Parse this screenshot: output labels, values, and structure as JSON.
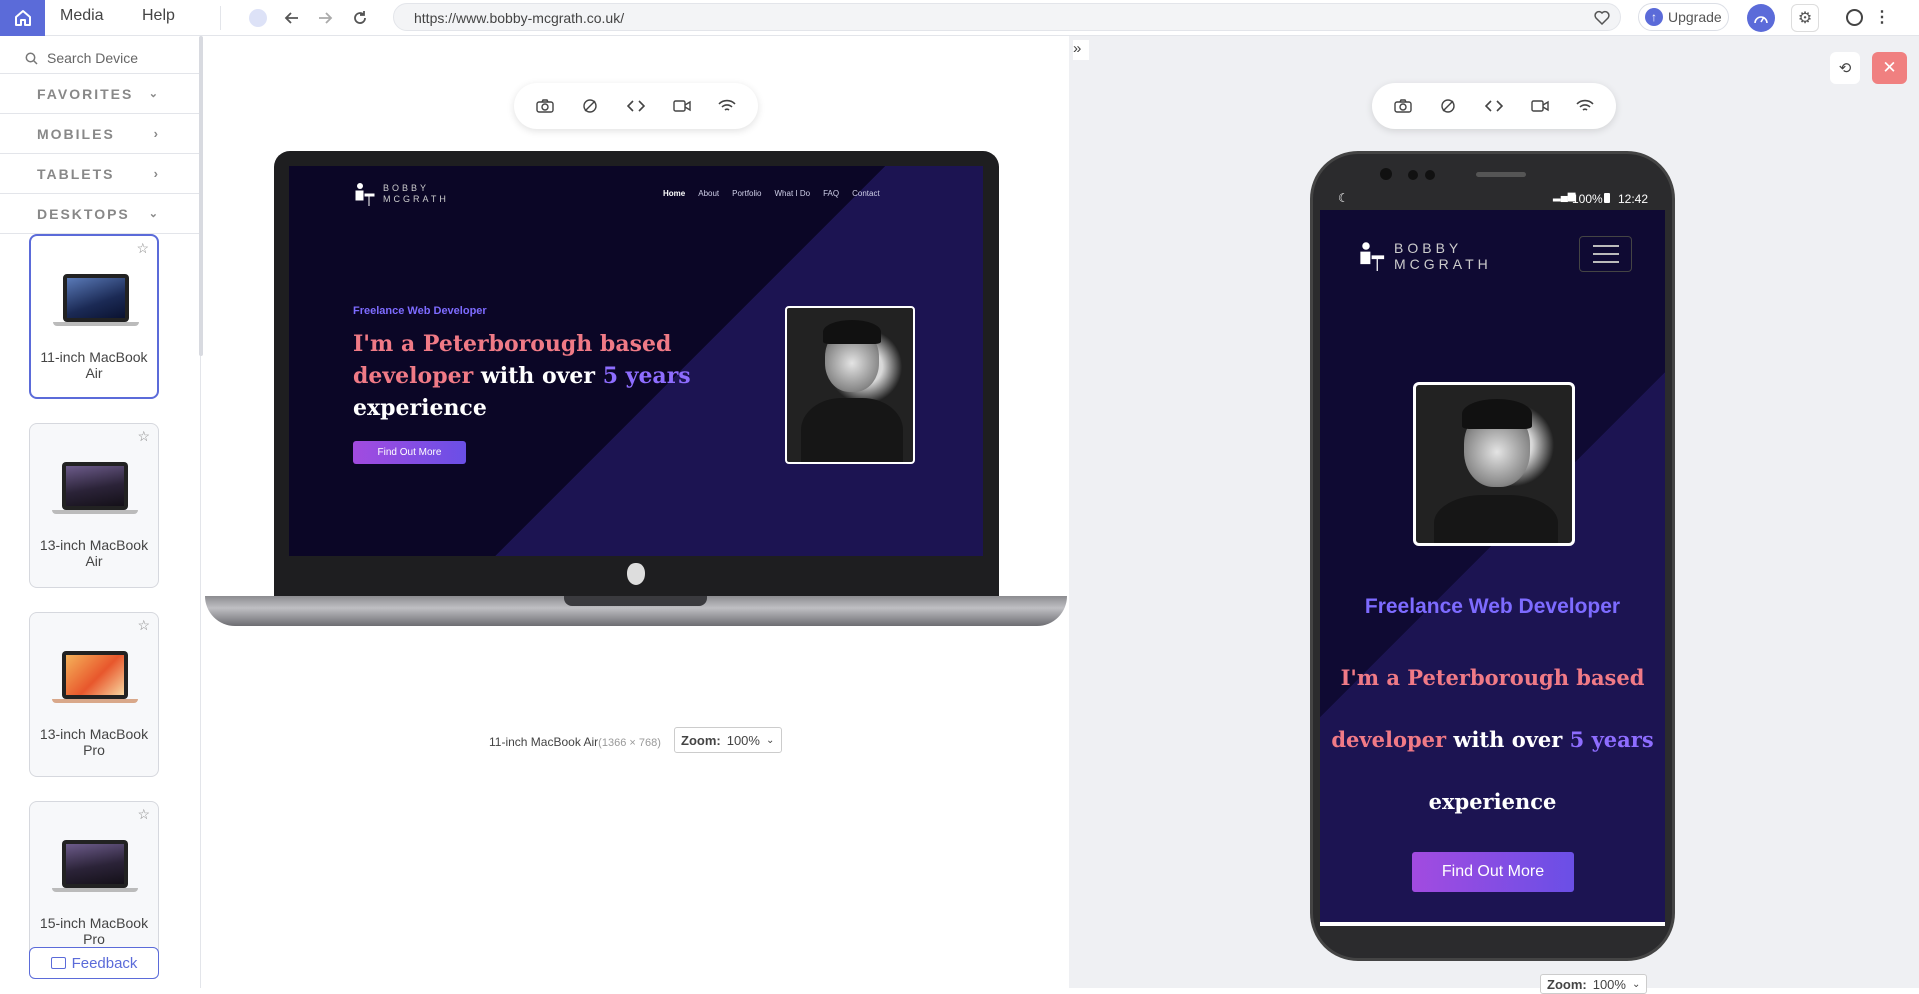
{
  "menu": {
    "media": "Media",
    "help": "Help"
  },
  "browser": {
    "url": "https://www.bobby-mcgrath.co.uk/",
    "upgrade": "Upgrade"
  },
  "sidebar": {
    "search_placeholder": "Search Device",
    "categories": [
      "FAVORITES",
      "MOBILES",
      "TABLETS",
      "DESKTOPS"
    ],
    "devices": [
      {
        "name": "11-inch MacBook Air"
      },
      {
        "name": "13-inch MacBook Air"
      },
      {
        "name": "13-inch MacBook Pro"
      },
      {
        "name": "15-inch MacBook Pro"
      }
    ],
    "feedback": "Feedback"
  },
  "site": {
    "logo_line1": "BOBBY",
    "logo_line2": "MCGRATH",
    "nav": [
      "Home",
      "About",
      "Portfolio",
      "What I Do",
      "FAQ",
      "Contact"
    ],
    "eyebrow": "Freelance Web Developer",
    "headline_1": "I'm a Peterborough based",
    "headline_2a": "developer",
    "headline_2b": "with over",
    "headline_2c": "5 years",
    "headline_3": "experience",
    "cta": "Find Out More"
  },
  "laptop_footer": {
    "device": "11-inch MacBook Air",
    "resolution": "(1366 × 768)",
    "zoom_label": "Zoom:",
    "zoom_value": "100%"
  },
  "phone": {
    "battery": "100%",
    "time": "12:42",
    "zoom_label": "Zoom:",
    "zoom_value": "100%"
  },
  "colors": {
    "accent": "#5b6bd9",
    "site_bg": "#0b0626",
    "salmon": "#f07a86",
    "purple": "#8e6dff",
    "close": "#f08080"
  }
}
